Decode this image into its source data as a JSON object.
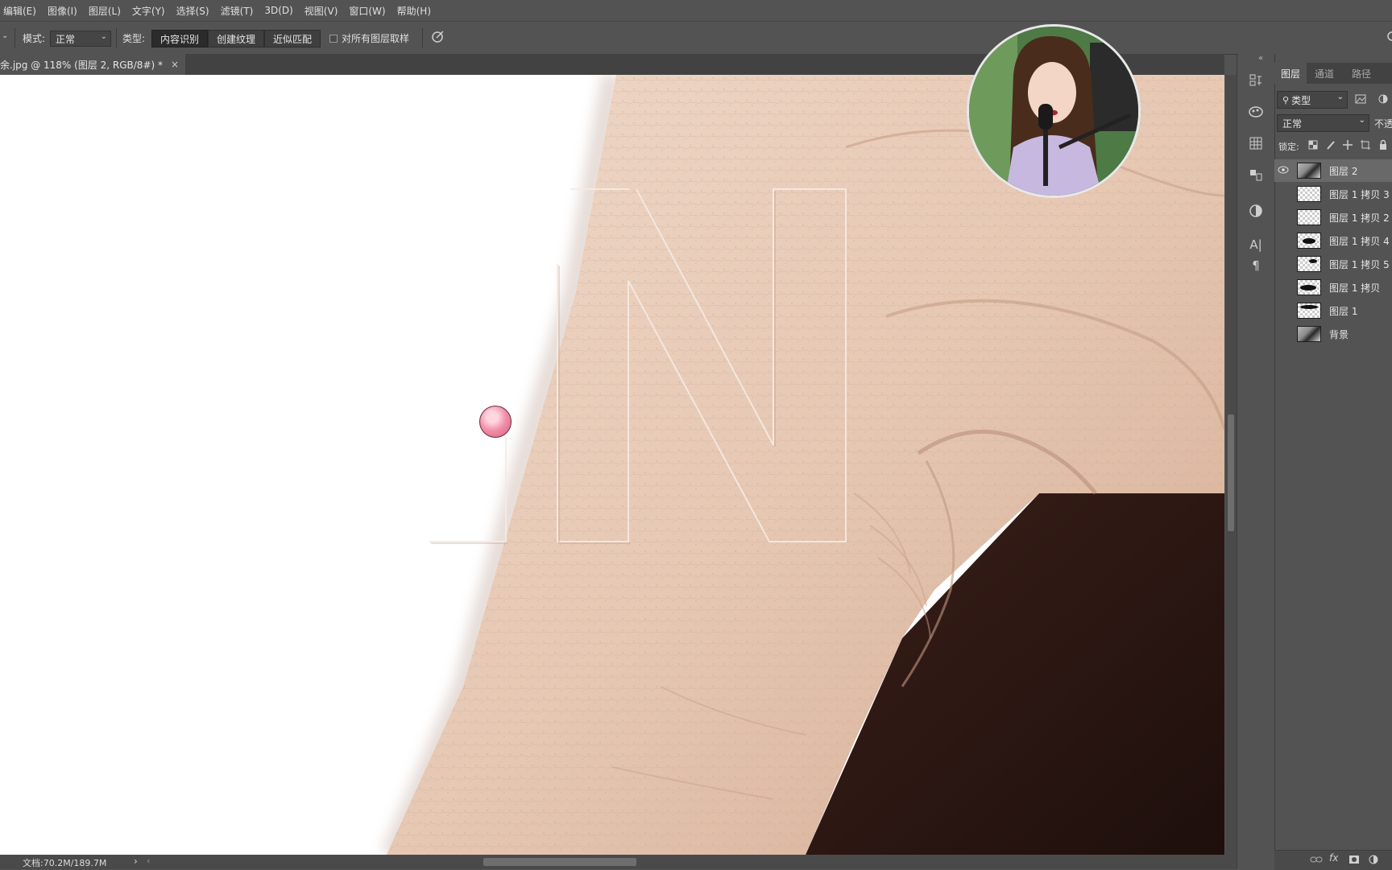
{
  "menu": [
    "编辑(E)",
    "图像(I)",
    "图层(L)",
    "文字(Y)",
    "选择(S)",
    "滤镜(T)",
    "3D(D)",
    "视图(V)",
    "窗口(W)",
    "帮助(H)"
  ],
  "options": {
    "mode_label": "模式:",
    "mode_value": "正常",
    "type_label": "类型:",
    "type_buttons": [
      "内容识别",
      "创建纹理",
      "近似匹配"
    ],
    "sample_all_layers": "对所有图层取样"
  },
  "document": {
    "tab_title": "余.jpg @ 118% (图层 2, RGB/8#) *",
    "close": "×"
  },
  "status": {
    "doc_size": "文档:70.2M/189.7M",
    "arrow": "›"
  },
  "layers_panel": {
    "tabs": [
      "图层",
      "通道",
      "路径"
    ],
    "filter_value": "类型",
    "blend_mode": "正常",
    "opacity_label": "不透",
    "lock_label": "锁定:",
    "layers": [
      {
        "name": "图层 2",
        "visible": true,
        "selected": true
      },
      {
        "name": "图层 1 拷贝 3",
        "visible": false,
        "selected": false
      },
      {
        "name": "图层 1 拷贝 2",
        "visible": false,
        "selected": false
      },
      {
        "name": "图层 1 拷贝 4",
        "visible": false,
        "selected": false
      },
      {
        "name": "图层 1 拷贝 5",
        "visible": false,
        "selected": false
      },
      {
        "name": "图层 1 拷贝",
        "visible": false,
        "selected": false
      },
      {
        "name": "图层 1",
        "visible": false,
        "selected": false
      },
      {
        "name": "背景",
        "visible": false,
        "selected": false
      }
    ],
    "footer_icons": [
      "link-icon",
      "fx-icon",
      "mask-icon",
      "adjustment-icon"
    ]
  },
  "colors": {
    "ui_bg": "#535353",
    "skin": "#e8c9b4",
    "dark_bg": "#2a1612"
  }
}
